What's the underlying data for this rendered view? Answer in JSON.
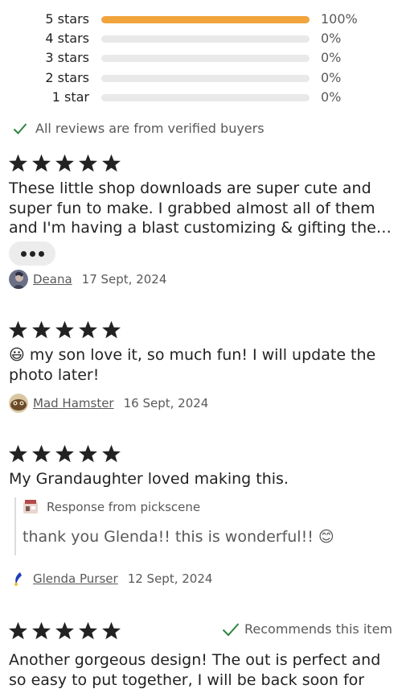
{
  "breakdown": [
    {
      "label": "5 stars",
      "pct_text": "100%",
      "fraction": 1.0
    },
    {
      "label": "4 stars",
      "pct_text": "0%",
      "fraction": 0
    },
    {
      "label": "3 stars",
      "pct_text": "0%",
      "fraction": 0
    },
    {
      "label": "2 stars",
      "pct_text": "0%",
      "fraction": 0
    },
    {
      "label": "1 star",
      "pct_text": "0%",
      "fraction": 0
    }
  ],
  "verified_text": "All reviews are from verified buyers",
  "colors": {
    "accent_bar": "#f1a43c",
    "check_green": "#2e8540",
    "star": "#222222"
  },
  "reviews": [
    {
      "rating": 5,
      "text": "These little shop downloads are super cute and super fun to make. I grabbed almost all of them and I'm having a blast customizing & gifting them to everyone I know!",
      "reviewer": "Deana",
      "date": "17 Sept, 2024"
    },
    {
      "rating": 5,
      "text": "😃 my son love it, so much fun! I will update the photo later!",
      "reviewer": "Mad Hamster",
      "date": "16 Sept, 2024"
    },
    {
      "rating": 5,
      "text": "My Grandaughter loved making this.",
      "response_label": "Response from pickscene",
      "response_text": "thank you Glenda!! this is wonderful!! 😊",
      "reviewer": "Glenda Purser",
      "date": "12 Sept, 2024"
    },
    {
      "rating": 5,
      "recommends": "Recommends this item",
      "text": "Another gorgeous design! The out is perfect and so easy to put together, I will be back soon for"
    }
  ]
}
